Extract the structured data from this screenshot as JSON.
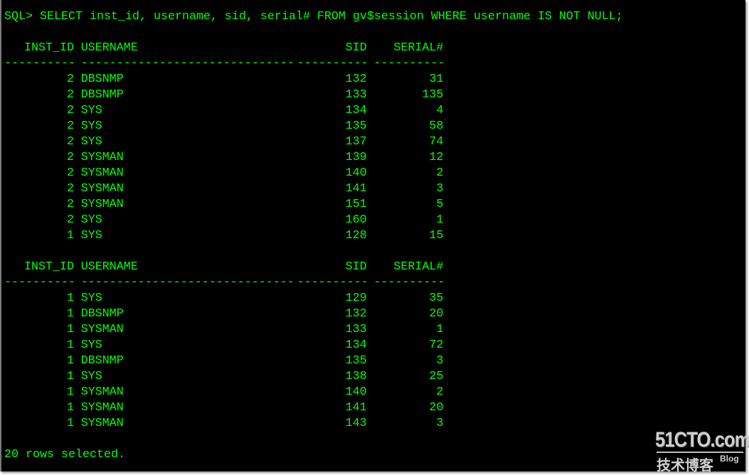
{
  "terminal": {
    "prompt": "SQL> ",
    "command": "SELECT inst_id, username, sid, serial# FROM gv$session WHERE username IS NOT NULL;",
    "headers": {
      "inst_id": "INST_ID",
      "username": "USERNAME",
      "sid": "SID",
      "serial": "SERIAL#"
    },
    "separators": {
      "inst_id": "----------",
      "username": "------------------------------",
      "sid": "----------",
      "serial": "----------"
    },
    "page1": [
      {
        "inst_id": "2",
        "username": "DBSNMP",
        "sid": "132",
        "serial": "31"
      },
      {
        "inst_id": "2",
        "username": "DBSNMP",
        "sid": "133",
        "serial": "135"
      },
      {
        "inst_id": "2",
        "username": "SYS",
        "sid": "134",
        "serial": "4"
      },
      {
        "inst_id": "2",
        "username": "SYS",
        "sid": "135",
        "serial": "58"
      },
      {
        "inst_id": "2",
        "username": "SYS",
        "sid": "137",
        "serial": "74"
      },
      {
        "inst_id": "2",
        "username": "SYSMAN",
        "sid": "139",
        "serial": "12"
      },
      {
        "inst_id": "2",
        "username": "SYSMAN",
        "sid": "140",
        "serial": "2"
      },
      {
        "inst_id": "2",
        "username": "SYSMAN",
        "sid": "141",
        "serial": "3"
      },
      {
        "inst_id": "2",
        "username": "SYSMAN",
        "sid": "151",
        "serial": "5"
      },
      {
        "inst_id": "2",
        "username": "SYS",
        "sid": "160",
        "serial": "1"
      },
      {
        "inst_id": "1",
        "username": "SYS",
        "sid": "128",
        "serial": "15"
      }
    ],
    "page2": [
      {
        "inst_id": "1",
        "username": "SYS",
        "sid": "129",
        "serial": "35"
      },
      {
        "inst_id": "1",
        "username": "DBSNMP",
        "sid": "132",
        "serial": "20"
      },
      {
        "inst_id": "1",
        "username": "SYSMAN",
        "sid": "133",
        "serial": "1"
      },
      {
        "inst_id": "1",
        "username": "SYS",
        "sid": "134",
        "serial": "72"
      },
      {
        "inst_id": "1",
        "username": "DBSNMP",
        "sid": "135",
        "serial": "3"
      },
      {
        "inst_id": "1",
        "username": "SYS",
        "sid": "138",
        "serial": "25"
      },
      {
        "inst_id": "1",
        "username": "SYSMAN",
        "sid": "140",
        "serial": "2"
      },
      {
        "inst_id": "1",
        "username": "SYSMAN",
        "sid": "141",
        "serial": "20"
      },
      {
        "inst_id": "1",
        "username": "SYSMAN",
        "sid": "143",
        "serial": "3"
      }
    ],
    "footer": "20 rows selected.",
    "text_color": "#00ff00",
    "background_color": "#000000"
  },
  "watermark": {
    "site": "51CTO.com",
    "subtitle_cn": "技术博客",
    "subtitle_en": "Blog"
  }
}
